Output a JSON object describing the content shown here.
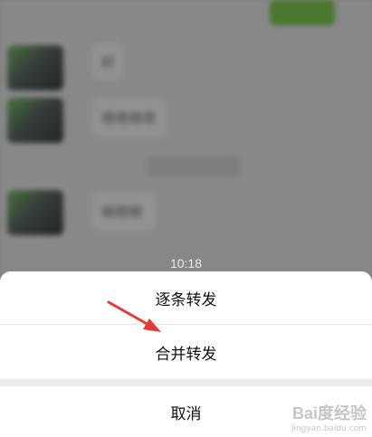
{
  "background_chat": {
    "bubble_text_1": "好",
    "bubble_text_2": "嗯嗯嗯嗯",
    "bubble_text_3": "啊啊啊"
  },
  "time_label": "10:18",
  "action_sheet": {
    "forward_one_by_one": "逐条转发",
    "forward_merged": "合并转发",
    "cancel": "取消"
  },
  "watermark": {
    "logo": "Bai度经验",
    "url": "jingyan.baidu.com"
  },
  "colors": {
    "overlay": "#000000",
    "sheet_bg": "#ffffff",
    "arrow": "#e53935",
    "green_bubble": "#7fcf52"
  }
}
